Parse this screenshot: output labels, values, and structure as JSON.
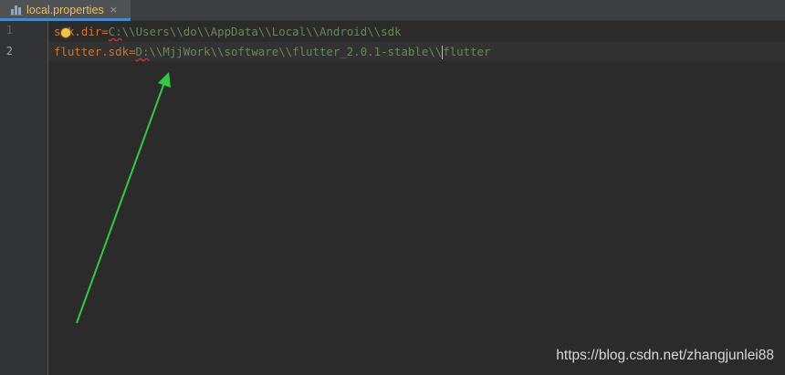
{
  "tab": {
    "label": "local.properties",
    "close_glyph": "×",
    "icon": "properties-file-icon"
  },
  "gutter": {
    "lines": [
      "1",
      "2"
    ]
  },
  "code": {
    "line1": {
      "key_start": "s",
      "key_end": "k.dir",
      "eq": "=",
      "drive": "C:",
      "path": "\\\\Users\\\\do\\\\AppData\\\\Local\\\\Android\\\\sdk"
    },
    "line2": {
      "key": "flutter.sdk",
      "eq": "=",
      "drive": "D:",
      "path_before_caret": "\\\\MjjWork\\\\software\\\\flutter_2.0.1-stable\\\\",
      "path_after_caret": "flutter"
    }
  },
  "colors": {
    "key": "#cc7832",
    "value": "#6a8759",
    "annotation_arrow": "#2ecc40",
    "tab_accent": "#4a88c7"
  },
  "watermark": "https://blog.csdn.net/zhangjunlei88"
}
